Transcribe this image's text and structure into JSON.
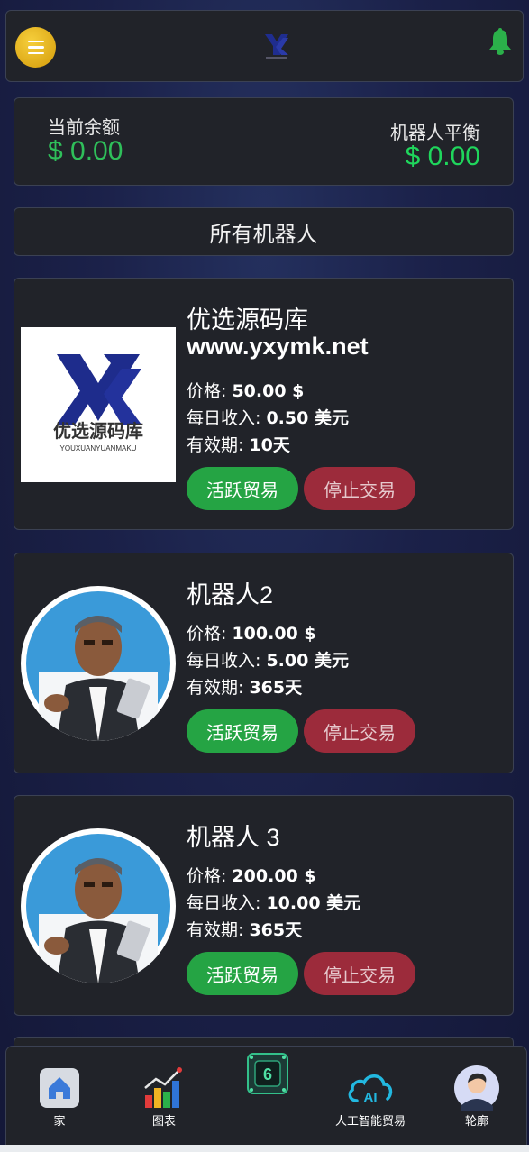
{
  "header": {
    "menu_icon": "menu-icon",
    "logo_icon": "yx-logo-icon",
    "bell_icon": "bell-icon"
  },
  "balance": {
    "current_label": "当前余额",
    "current_value": "$ 0.00",
    "robot_label": "机器人平衡",
    "robot_value": "$ 0.00"
  },
  "all_bots_label": "所有机器人",
  "bots": [
    {
      "title": "优选源码库",
      "subtitle": "www.yxymk.net",
      "price_label": "价格:",
      "price_value": "50.00 $",
      "daily_label": "每日收入:",
      "daily_value": "0.50 美元",
      "validity_label": "有效期:",
      "validity_value": "10天",
      "active_label": "活跃贸易",
      "stop_label": "停止交易",
      "logo_text": "优选源码库",
      "logo_subtext": "YOUXUANYUANMAKU"
    },
    {
      "title": "机器人2",
      "price_label": "价格:",
      "price_value": "100.00 $",
      "daily_label": "每日收入:",
      "daily_value": "5.00 美元",
      "validity_label": "有效期:",
      "validity_value": "365天",
      "active_label": "活跃贸易",
      "stop_label": "停止交易"
    },
    {
      "title": "机器人 3",
      "price_label": "价格:",
      "price_value": "200.00 $",
      "daily_label": "每日收入:",
      "daily_value": "10.00 美元",
      "validity_label": "有效期:",
      "validity_value": "365天",
      "active_label": "活跃贸易",
      "stop_label": "停止交易"
    }
  ],
  "nav": [
    {
      "label": "家",
      "icon": "home-icon"
    },
    {
      "label": "图表",
      "icon": "chart-icon"
    },
    {
      "label": "",
      "icon": "chip-icon"
    },
    {
      "label": "人工智能贸易",
      "icon": "ai-cloud-icon"
    },
    {
      "label": "轮廓",
      "icon": "avatar-icon"
    }
  ],
  "colors": {
    "accent_green": "#25a444",
    "stop_red": "#9c2b3b",
    "balance_green": "#2fbf5a",
    "card_bg": "#212329"
  }
}
